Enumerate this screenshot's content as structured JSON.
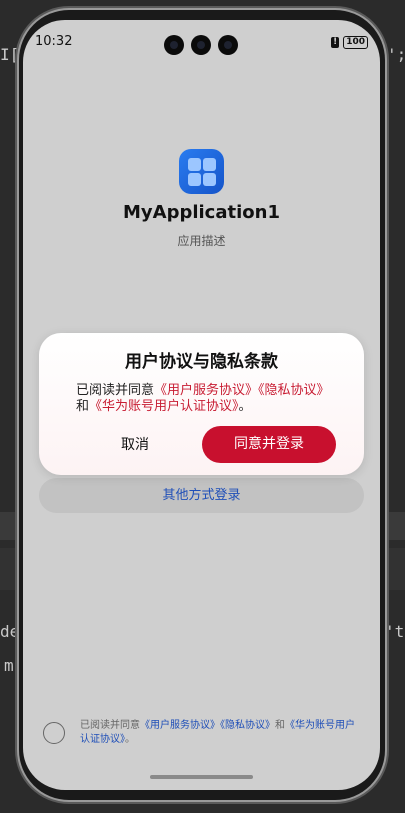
{
  "ide": {
    "frag_top_left": "I[",
    "frag_top_right": "';",
    "frag_mid_left": "de",
    "frag_mid_right": "'tr",
    "frag_low_left": "m"
  },
  "status_bar": {
    "time": "10:32",
    "battery": "100"
  },
  "app": {
    "icon": "app-grid-icon",
    "name": "MyApplication1",
    "description": "应用描述"
  },
  "other_login": {
    "label": "其他方式登录"
  },
  "bottom_agreement": {
    "prefix": "已阅读并同意",
    "link1": "《用户服务协议》",
    "link2": "《隐私协议》",
    "and": "和",
    "link3": "《华为账号用户认证协议》",
    "suffix": "。"
  },
  "dialog": {
    "title": "用户协议与隐私条款",
    "body_prefix": "已阅读并同意",
    "link1": "《用户服务协议》",
    "link2": "《隐私协议》",
    "and": "和",
    "link3": "《华为账号用户认证协议》",
    "suffix": "。",
    "cancel": "取消",
    "agree": "同意并登录"
  },
  "colors": {
    "accent_red": "#c8102e",
    "link_blue": "#1f4fb8",
    "link_red": "#c81d33"
  }
}
